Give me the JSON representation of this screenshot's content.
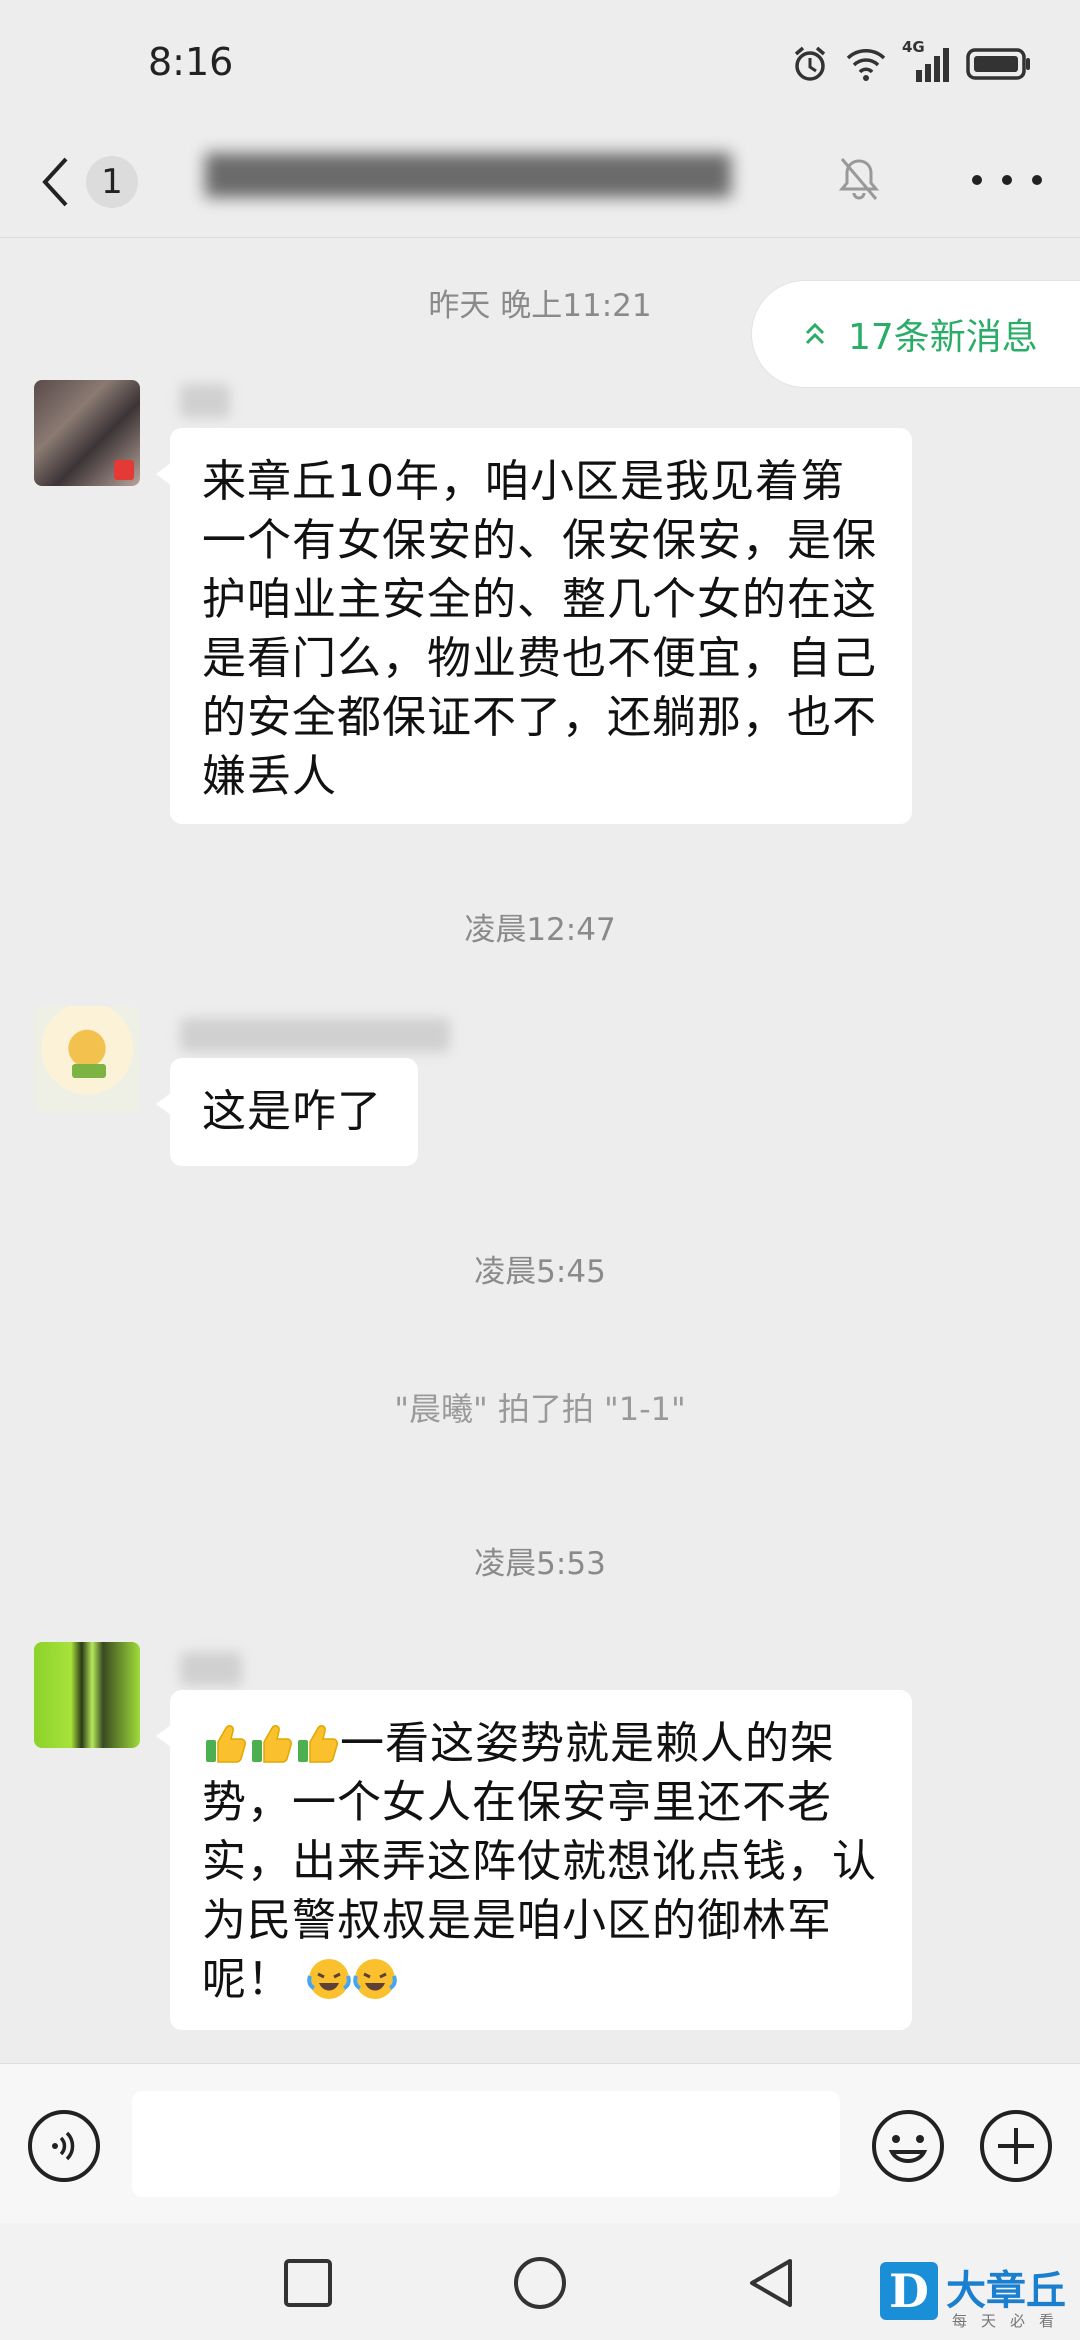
{
  "status_bar": {
    "time": "8:16",
    "network": "4G"
  },
  "header": {
    "unread_count": "1",
    "title": "██████████████████"
  },
  "new_messages": {
    "label": "17条新消息"
  },
  "chat": {
    "timestamps": [
      "昨天 晚上11:21",
      "凌晨12:47",
      "凌晨5:45",
      "凌晨5:53"
    ],
    "messages": [
      {
        "text": "来章丘10年，咱小区是我见着第一个有女保安的、保安保安，是保护咱业主安全的、整几个女的在这是看门么，物业费也不便宜，自己的安全都保证不了，还躺那，也不嫌丢人"
      },
      {
        "text": "这是咋了"
      },
      {
        "text_before": "",
        "text_main": "一看这姿势就是赖人的架势，一个女人在保安亭里还不老实，出来弄这阵仗就想讹点钱，认为民警叔叔是是咱小区的御林军呢！"
      }
    ],
    "system": "\"晨曦\" 拍了拍 \"1-1\""
  },
  "input": {
    "placeholder": ""
  },
  "watermark": {
    "brand": "大章丘",
    "slogan": "每天必看",
    "logo": "D"
  },
  "colors": {
    "accent_green": "#2aae67",
    "background": "#ededed"
  }
}
